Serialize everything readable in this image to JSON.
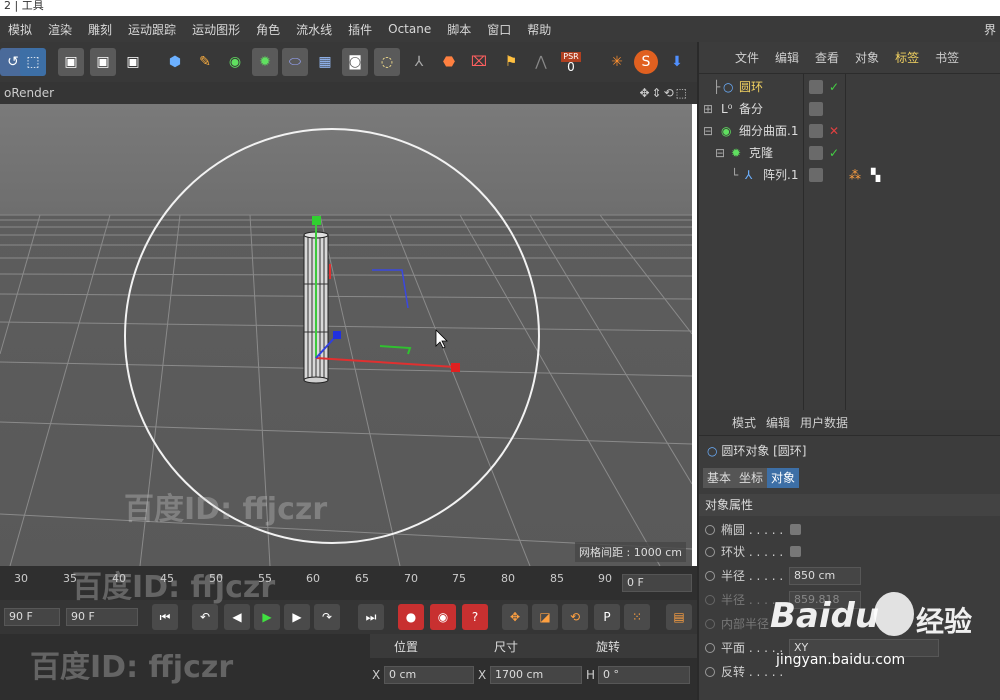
{
  "title_fragment": "2 | 工具",
  "menu": {
    "items": [
      "模拟",
      "渲染",
      "雕刻",
      "运动跟踪",
      "运动图形",
      "角色",
      "流水线",
      "插件",
      "Octane",
      "脚本",
      "窗口",
      "帮助"
    ],
    "right": "界"
  },
  "viewport": {
    "title": "oRender",
    "grid_info": "网格间距 : 1000 cm"
  },
  "toolbar": {
    "psr_label": "PSR",
    "psr_value": "0"
  },
  "timeline": {
    "ticks": [
      "30",
      "35",
      "40",
      "45",
      "50",
      "55",
      "60",
      "65",
      "70",
      "75",
      "80",
      "85",
      "90"
    ],
    "frame": "0 F"
  },
  "transport": {
    "start_field": "90 F",
    "end_field": "90 F"
  },
  "coords": {
    "pos": "位置",
    "size": "尺寸",
    "rot": "旋转",
    "x_label": "X",
    "x_pos": "0 cm",
    "x2_label": "X",
    "x_size": "1700 cm",
    "h_label": "H",
    "h_rot": "0 °"
  },
  "object_manager": {
    "tabs": [
      "文件",
      "编辑",
      "查看",
      "对象",
      "标签",
      "书签"
    ],
    "active_tab": 4,
    "rows": [
      {
        "name": "圆环",
        "status": "✓",
        "status_color": "#44d044",
        "highlight": true
      },
      {
        "name": "备分",
        "status": "",
        "status_color": "#aaa",
        "highlight": false
      },
      {
        "name": "细分曲面.1",
        "status": "✕",
        "status_color": "#e04040",
        "highlight": false
      },
      {
        "name": "克隆",
        "status": "✓",
        "status_color": "#44d044",
        "highlight": false
      },
      {
        "name": "阵列.1",
        "status": "",
        "status_color": "#aaa",
        "highlight": false
      }
    ]
  },
  "attributes": {
    "tabs": [
      "模式",
      "编辑",
      "用户数据"
    ],
    "object_title": "圆环对象 [圆环]",
    "subtabs": [
      "基本",
      "坐标",
      "对象"
    ],
    "section": "对象属性",
    "props": [
      {
        "label": "椭圆 . . . . .",
        "value": ""
      },
      {
        "label": "环状 . . . . .",
        "value": ""
      },
      {
        "label": "半径 . . . . .",
        "value": "850 cm"
      },
      {
        "label": "半径 . . . . .",
        "value": "859.818"
      },
      {
        "label": "内部半径",
        "value": ""
      },
      {
        "label": "平面 . . . . .",
        "value": "XY"
      },
      {
        "label": "反转 . . . . .",
        "value": ""
      }
    ]
  },
  "watermarks": [
    "百度ID: ffjczr",
    "百度ID: ffjczr",
    "百度ID: ffjczr"
  ],
  "baidu": {
    "logo": "Baidu",
    "text": "经验",
    "url": "jingyan.baidu.com"
  },
  "colors": {
    "highlight": "#f0d060",
    "accent_blue": "#3d6fa6"
  }
}
